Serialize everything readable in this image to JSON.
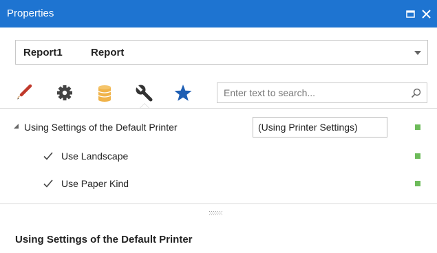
{
  "window": {
    "title": "Properties",
    "buttons": {
      "maximize": "maximize",
      "close": "close"
    }
  },
  "object_selector": {
    "name": "Report1",
    "type": "Report"
  },
  "tabs": [
    {
      "icon": "brush-icon",
      "label": "Appearance",
      "selected": false
    },
    {
      "icon": "gear-icon",
      "label": "Behavior",
      "selected": false
    },
    {
      "icon": "database-icon",
      "label": "Data",
      "selected": false
    },
    {
      "icon": "wrench-icon",
      "label": "Misc",
      "selected": true
    },
    {
      "icon": "star-icon",
      "label": "Favorites",
      "selected": false
    }
  ],
  "search": {
    "placeholder": "Enter text to search...",
    "value": ""
  },
  "property_grid": {
    "category": {
      "label": "Using Settings of the Default Printer",
      "value": "(Using Printer Settings)",
      "expanded": true
    },
    "properties": [
      {
        "label": "Use Landscape",
        "checked": true
      },
      {
        "label": "Use Paper Kind",
        "checked": true
      }
    ]
  },
  "description": {
    "title": "Using Settings of the Default Printer"
  },
  "colors": {
    "titlebar": "#1e74d1",
    "modified_marker": "#6dbb5a",
    "star": "#1f5fb4",
    "database": "#f0b34a"
  }
}
